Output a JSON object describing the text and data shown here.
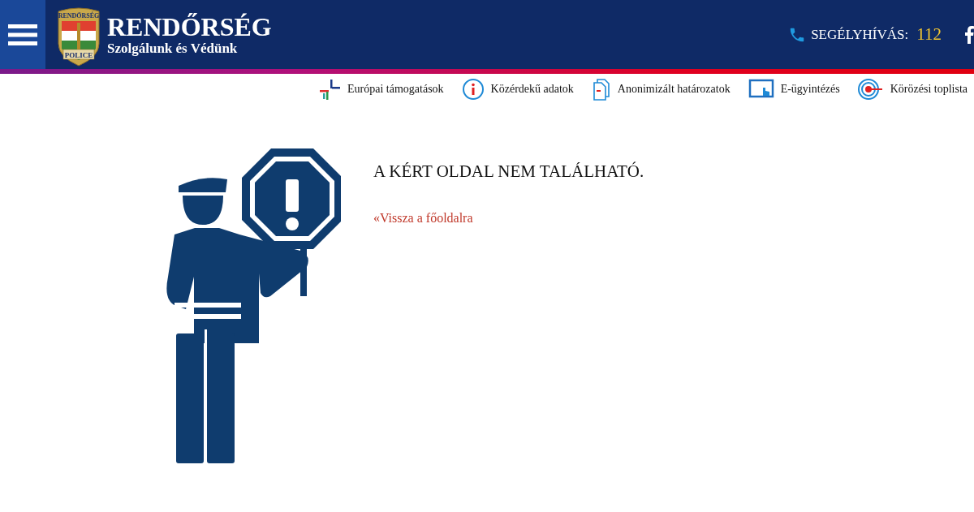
{
  "header": {
    "logo": {
      "badge_top": "RENDŐRSÉG",
      "badge_bottom": "POLICE",
      "title": "RENDŐRSÉG",
      "slogan": "Szolgálunk és Védünk"
    },
    "emergency": {
      "label": "SEGÉLYHÍVÁS:",
      "number": "112"
    }
  },
  "quick_links": [
    {
      "label": "Európai támogatások",
      "kind": "cross"
    },
    {
      "label": "Közérdekű adatok",
      "kind": "info"
    },
    {
      "label": "Anonimizált határozatok",
      "kind": "documents"
    },
    {
      "label": "E-ügyintézés",
      "kind": "tablet"
    },
    {
      "label": "Körözési toplista",
      "kind": "target"
    }
  ],
  "error": {
    "heading": "A KÉRT OLDAL NEM TALÁLHATÓ.",
    "back_link": "«Vissza a főoldalra"
  }
}
